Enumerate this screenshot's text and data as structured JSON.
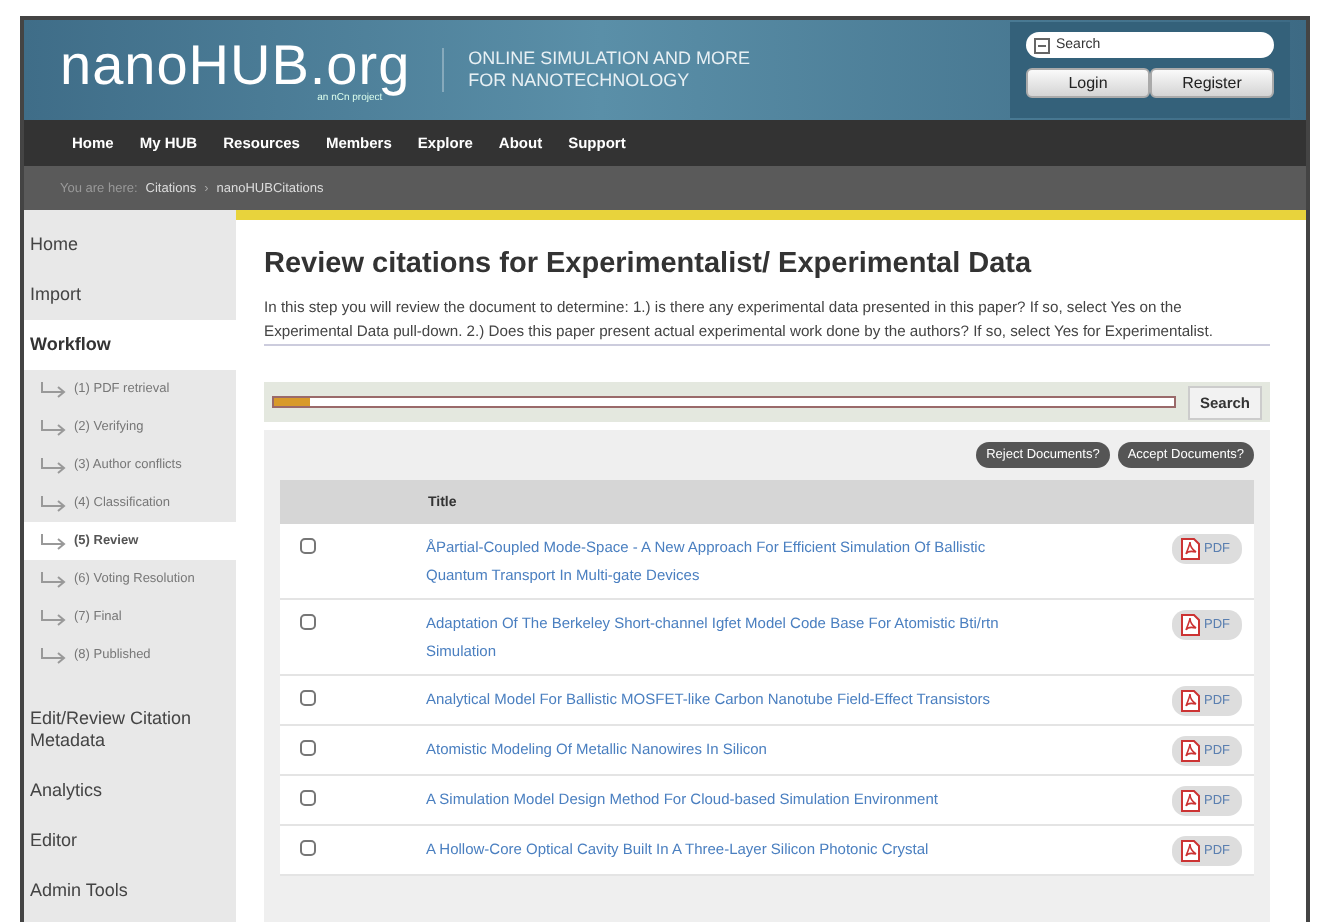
{
  "header": {
    "logo": "nanoHUB.org",
    "logo_sub": "an nCn project",
    "tagline": [
      "ONLINE SIMULATION AND MORE",
      "FOR NANOTECHNOLOGY"
    ],
    "search": {
      "placeholder": "Search"
    },
    "buttons": [
      "Login",
      "Register"
    ]
  },
  "nav": [
    "Home",
    "My HUB",
    "Resources",
    "Members",
    "Explore",
    "About",
    "Support"
  ],
  "breadcrumb": {
    "label": "You are here:",
    "items": [
      "Citations",
      "nanoHUBCitations"
    ],
    "separator": "›"
  },
  "sidebar": {
    "items": [
      {
        "label": "Home",
        "selected": false
      },
      {
        "label": "Import",
        "selected": false
      },
      {
        "label": "Workflow",
        "selected": true,
        "children": [
          {
            "label": "(1) PDF retrieval",
            "selected": false
          },
          {
            "label": "(2) Verifying",
            "selected": false
          },
          {
            "label": "(3) Author conflicts",
            "selected": false
          },
          {
            "label": "(4) Classification",
            "selected": false
          },
          {
            "label": "(5) Review",
            "selected": true
          },
          {
            "label": "(6) Voting Resolution",
            "selected": false
          },
          {
            "label": "(7) Final",
            "selected": false
          },
          {
            "label": "(8) Published",
            "selected": false
          }
        ]
      },
      {
        "label": "Edit/Review Citation Metadata",
        "selected": false
      },
      {
        "label": "Analytics",
        "selected": false
      },
      {
        "label": "Editor",
        "selected": false
      },
      {
        "label": "Admin Tools",
        "selected": false
      }
    ]
  },
  "main": {
    "title": "Review citations for Experimentalist/ Experimental Data",
    "description": "In this step you will review the document to determine: 1.) is there any experimental data presented in this paper? If so, select Yes on the Experimental Data pull-down. 2.) Does this paper present actual experimental work done by the authors? If so, select Yes for Experimentalist.",
    "search_button": "Search",
    "progress": {
      "level": 0.04
    },
    "actions": [
      "Reject Documents?",
      "Accept Documents?"
    ],
    "table": {
      "columns": [
        "Title"
      ],
      "rows": [
        {
          "title": "ÅPartial-Coupled Mode-Space - A New Approach For Efficient Simulation Of Ballistic Quantum Transport In Multi-gate Devices",
          "checked": false,
          "pdf": "PDF"
        },
        {
          "title": "Adaptation Of The Berkeley Short-channel Igfet Model Code Base For Atomistic Bti/rtn Simulation",
          "checked": false,
          "pdf": "PDF"
        },
        {
          "title": "Analytical Model For Ballistic MOSFET-like Carbon Nanotube Field-Effect Transistors",
          "checked": false,
          "pdf": "PDF"
        },
        {
          "title": "Atomistic Modeling Of Metallic Nanowires In Silicon",
          "checked": false,
          "pdf": "PDF"
        },
        {
          "title": "A Simulation Model Design Method For Cloud-based Simulation Environment",
          "checked": false,
          "pdf": "PDF"
        },
        {
          "title": "A Hollow-Core Optical Cavity Built In A Three-Layer Silicon Photonic Crystal",
          "checked": false,
          "pdf": "PDF"
        }
      ]
    }
  }
}
